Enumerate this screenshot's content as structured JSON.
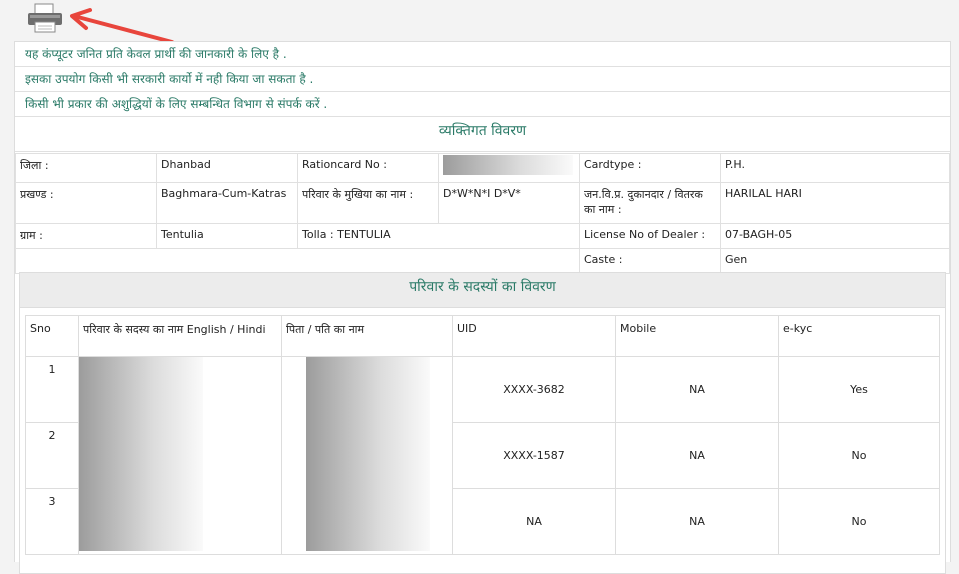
{
  "notices": [
    "यह कंप्यूटर जनित प्रति केवल प्रार्थी की जानकारी के लिए है .",
    "इसका उपयोग किसी भी सरकारी कार्यो में नही किया जा सकता है .",
    "किसी भी प्रकार की अशुद्धियों के लिए सम्बन्धित विभाग से संपर्क करें ."
  ],
  "personal": {
    "title": "व्यक्तिगत विवरण",
    "district_label": "जिला :",
    "district_value": "Dhanbad",
    "rationcard_label": "Rationcard No :",
    "cardtype_label": "Cardtype :",
    "cardtype_value": "P.H.",
    "block_label": "प्रखण्ड :",
    "block_value": "Baghmara-Cum-Katras",
    "head_label": "परिवार के मुखिया का नाम :",
    "head_value": "D*W*N*I D*V*",
    "dealer_label": "जन.वि.प्र. दुकानदार / वितरक का नाम :",
    "dealer_value": "HARILAL HARI",
    "village_label": "ग्राम :",
    "village_value": "Tentulia",
    "tolla_label": "Tolla : TENTULIA",
    "license_label": "License No of Dealer :",
    "license_value": "07-BAGH-05",
    "caste_label": "Caste :",
    "caste_value": "Gen"
  },
  "members": {
    "title": "परिवार के सदस्यों का विवरण",
    "headers": [
      "Sno",
      "परिवार के सदस्य का नाम English / Hindi",
      "पिता / पति का नाम",
      "UID",
      "Mobile",
      "e-kyc"
    ],
    "rows": [
      {
        "sno": "1",
        "uid": "XXXX-3682",
        "mobile": "NA",
        "ekyc": "Yes"
      },
      {
        "sno": "2",
        "uid": "XXXX-1587",
        "mobile": "NA",
        "ekyc": "No"
      },
      {
        "sno": "3",
        "uid": "NA",
        "mobile": "NA",
        "ekyc": "No"
      }
    ]
  },
  "icons": {
    "printer": "printer-icon",
    "arrow": "red-arrow"
  },
  "colors": {
    "accent": "#2a7a67",
    "arrow": "#e8453c"
  }
}
